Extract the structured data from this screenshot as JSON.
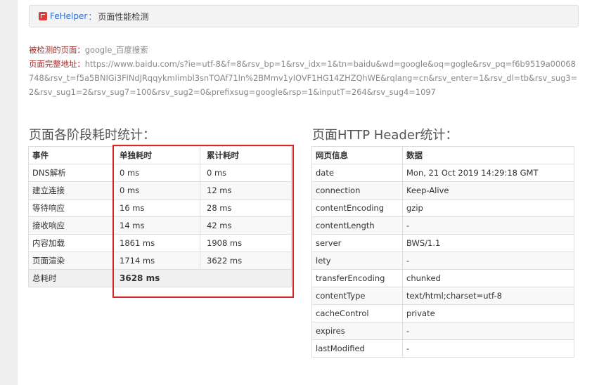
{
  "topbar": {
    "brand": "FeHelper",
    "separator": "：",
    "tool_title": "页面性能检测"
  },
  "info": {
    "page_label": "被检测的页面：",
    "page_value": "google_百度搜索",
    "url_label": "页面完整地址：",
    "url_value": "https://www.baidu.com/s?ie=utf-8&f=8&rsv_bp=1&rsv_idx=1&tn=baidu&wd=google&oq=gogle&rsv_pq=f6b9519a00068748&rsv_t=f5a5BNIGi3FlNdJRqqykmIimbl3snTOAf71ln%2BMmv1yIOVF1HG14ZHZQhWE&rqlang=cn&rsv_enter=1&rsv_dl=tb&rsv_sug3=2&rsv_sug1=2&rsv_sug7=100&rsv_sug2=0&prefixsug=google&rsp=1&inputT=264&rsv_sug4=1097"
  },
  "timing": {
    "title": "页面各阶段耗时统计：",
    "headers": [
      "事件",
      "单独耗时",
      "累计耗时"
    ],
    "rows": [
      [
        "DNS解析",
        "0 ms",
        "0 ms"
      ],
      [
        "建立连接",
        "0 ms",
        "12 ms"
      ],
      [
        "等待响应",
        "16 ms",
        "28 ms"
      ],
      [
        "接收响应",
        "14 ms",
        "42 ms"
      ],
      [
        "内容加载",
        "1861 ms",
        "1908 ms"
      ],
      [
        "页面渲染",
        "1714 ms",
        "3622 ms"
      ]
    ],
    "total_label": "总耗时",
    "total_value": "3628 ms"
  },
  "headers": {
    "title": "页面HTTP Header统计：",
    "columns": [
      "网页信息",
      "数据"
    ],
    "rows": [
      [
        "date",
        "Mon, 21 Oct 2019 14:29:18 GMT"
      ],
      [
        "connection",
        "Keep-Alive"
      ],
      [
        "contentEncoding",
        "gzip"
      ],
      [
        "contentLength",
        "-"
      ],
      [
        "server",
        "BWS/1.1"
      ],
      [
        "lety",
        "-"
      ],
      [
        "transferEncoding",
        "chunked"
      ],
      [
        "contentType",
        "text/html;charset=utf-8"
      ],
      [
        "cacheControl",
        "private"
      ],
      [
        "expires",
        "-"
      ],
      [
        "lastModified",
        "-"
      ]
    ]
  },
  "colors": {
    "highlight": "#d9232b",
    "brand": "#2b6fd6",
    "label": "#9c2a2a"
  }
}
